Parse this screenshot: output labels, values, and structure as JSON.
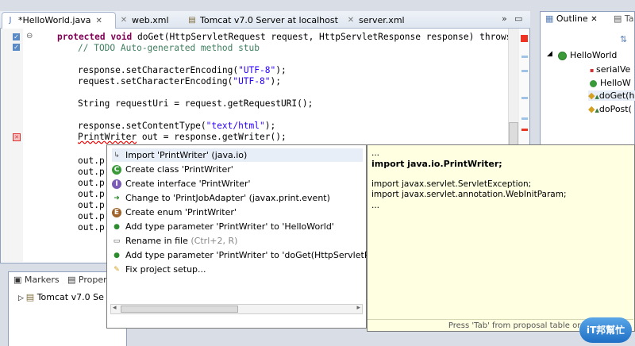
{
  "tabs": [
    {
      "label": "*HelloWorld.java",
      "icon": "java-file-icon",
      "active": true
    },
    {
      "label": "web.xml",
      "icon": "xml-file-icon"
    },
    {
      "label": "Tomcat v7.0 Server at localhost",
      "icon": "server-icon"
    },
    {
      "label": "server.xml",
      "icon": "xml-file-icon"
    }
  ],
  "code": {
    "l1_kw": "protected void",
    "l1_rest": " doGet(HttpServletRequest request, HttpServletResponse response) throws",
    "l2": "// TODO Auto-generated method stub",
    "l3_a": "response.setCharacterEncoding(",
    "l3_s": "\"UTF-8\"",
    "l3_b": ");",
    "l4_a": "request.setCharacterEncoding(",
    "l4_s": "\"UTF-8\"",
    "l4_b": ");",
    "l5": "String requestUri = request.getRequestURI();",
    "l6_a": "response.setContentType(",
    "l6_s": "\"text/html\"",
    "l6_b": ");",
    "l7_err": "PrintWriter",
    "l7_rest": " out = response.getWriter();",
    "out_lines": [
      "out.p",
      "out.p",
      "out.p",
      "out.p",
      "out.p",
      "out.p",
      "out.p"
    ]
  },
  "outline": {
    "tab_label": "Outline",
    "tab2_label": "Ta",
    "class_name": "HelloWorld",
    "members": [
      "serialVe",
      "HelloW",
      "doGet(h",
      "doPost("
    ]
  },
  "bottom": {
    "tab1": "Markers",
    "tab2": "Proper",
    "server_item": "Tomcat v7.0 Se"
  },
  "proposals": [
    {
      "label": "Import 'PrintWriter' (java.io)",
      "icon": "import-icon"
    },
    {
      "label": "Create class 'PrintWriter'",
      "icon": "class-icon",
      "letter": "C"
    },
    {
      "label": "Create interface 'PrintWriter'",
      "icon": "interface-icon",
      "letter": "I"
    },
    {
      "label": "Change to 'PrintJobAdapter' (javax.print.event)",
      "icon": "change-icon"
    },
    {
      "label": "Create enum 'PrintWriter'",
      "icon": "enum-icon",
      "letter": "E"
    },
    {
      "label": "Add type parameter 'PrintWriter' to 'HelloWorld'",
      "icon": "type-param-icon"
    },
    {
      "label": "Rename in file",
      "hint": " (Ctrl+2, R)",
      "icon": "rename-icon"
    },
    {
      "label": "Add type parameter 'PrintWriter' to 'doGet(HttpServletReque",
      "icon": "type-param-icon"
    },
    {
      "label": "Fix project setup...",
      "icon": "fix-project-icon"
    }
  ],
  "info": {
    "ellipsis_top": "...",
    "import_line": "import java.io.PrintWriter;",
    "import2": "import javax.servlet.ServletException;",
    "import3": "import javax.servlet.annotation.WebInitParam;",
    "ellipsis_bottom": "...",
    "status": "Press 'Tab' from proposal table or c"
  },
  "logo": {
    "text": "iT邦幫忙"
  }
}
